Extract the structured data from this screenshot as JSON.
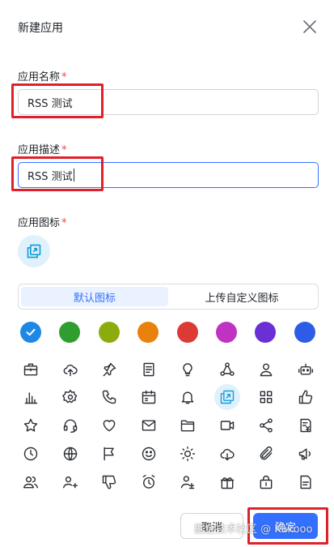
{
  "dialog": {
    "title": "新建应用"
  },
  "name_field": {
    "label": "应用名称",
    "required_mark": "*",
    "value": "RSS 测试"
  },
  "desc_field": {
    "label": "应用描述",
    "required_mark": "*",
    "value": "RSS 测试"
  },
  "icon_field": {
    "label": "应用图标",
    "required_mark": "*",
    "selected_icon": "app-window-icon"
  },
  "tabs": [
    {
      "label": "默认图标",
      "active": true
    },
    {
      "label": "上传自定义图标",
      "active": false
    }
  ],
  "colors": [
    "#1e88e5",
    "#2e9e2e",
    "#8cac0e",
    "#e8820c",
    "#dc3a35",
    "#bf32c2",
    "#6b2fd6",
    "#2f5ce6"
  ],
  "selected_color_index": 0,
  "icons": [
    [
      "briefcase-icon",
      "cloud-upload-icon",
      "pin-icon",
      "document-icon",
      "lightbulb-icon",
      "cluster-icon",
      "user-icon",
      "robot-icon"
    ],
    [
      "bar-chart-icon",
      "settings-icon",
      "phone-icon",
      "calendar-icon",
      "bell-icon",
      "app-window-icon",
      "grid-icon",
      "thumbs-up-icon"
    ],
    [
      "star-icon",
      "headset-icon",
      "heart-icon",
      "mail-icon",
      "folder-icon",
      "video-icon",
      "share-icon",
      "invoice-icon"
    ],
    [
      "clock-icon",
      "globe-icon",
      "flag-icon",
      "smile-icon",
      "sun-icon",
      "cloud-download-icon",
      "paperclip-icon",
      "megaphone-icon"
    ],
    [
      "users-icon",
      "add-user-icon",
      "thumbs-down-icon",
      "alarm-icon",
      "user-balance-icon",
      "gift-icon",
      "lock-bag-icon",
      "notes-icon"
    ]
  ],
  "buttons": {
    "cancel": "取消",
    "ok": "确定"
  },
  "watermark": "掘金技术社区 @ Kakooo",
  "accent": "#3370ff"
}
